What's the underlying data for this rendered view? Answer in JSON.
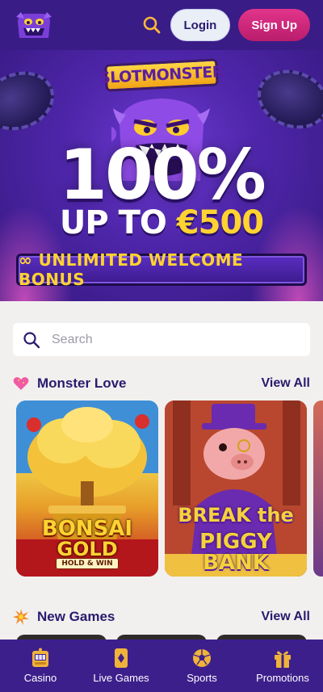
{
  "header": {
    "logo_name": "slotmonster-logo",
    "login_label": "Login",
    "signup_label": "Sign Up"
  },
  "hero": {
    "brand": "SLOTMONSTER",
    "headline": "100%",
    "sub_prefix": "UP TO ",
    "sub_amount": "€500",
    "bonus": "∞ UNLIMITED WELCOME BONUS"
  },
  "search": {
    "placeholder": "Search"
  },
  "sections": [
    {
      "title": "Monster Love",
      "view_all": "View All",
      "icon": "heart-icon",
      "games": [
        {
          "title_line1": "BONSAI",
          "title_line2": "GOLD",
          "tag": "HOLD & WIN"
        },
        {
          "title_line1": "BREAK the",
          "title_line2": "PIGGY BANK"
        }
      ]
    },
    {
      "title": "New Games",
      "view_all": "View All",
      "icon": "burst-icon"
    }
  ],
  "nav": [
    {
      "label": "Casino",
      "icon": "slot-machine-icon"
    },
    {
      "label": "Live Games",
      "icon": "playing-card-icon"
    },
    {
      "label": "Sports",
      "icon": "soccer-ball-icon"
    },
    {
      "label": "Promotions",
      "icon": "gift-icon"
    }
  ],
  "colors": {
    "header_bg": "#3a1c87",
    "accent_pink": "#d62a7f",
    "accent_gold": "#ffd331",
    "text_dark": "#2b1a6e",
    "page_bg": "#f2f0ef"
  }
}
